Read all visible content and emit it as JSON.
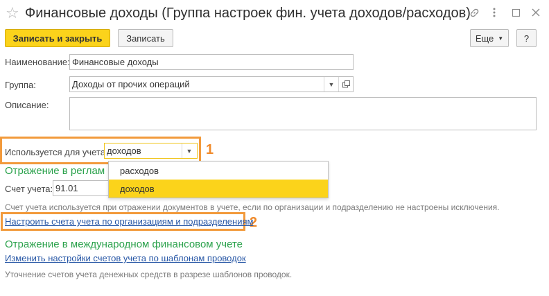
{
  "window": {
    "title": "Финансовые доходы (Группа настроек фин. учета доходов/расходов)"
  },
  "toolbar": {
    "save_close_label": "Записать и закрыть",
    "save_label": "Записать",
    "more_label": "Еще",
    "help_label": "?"
  },
  "form": {
    "name_label": "Наименование:",
    "name_value": "Финансовые доходы",
    "group_label": "Группа:",
    "group_value": "Доходы от прочих операций",
    "description_label": "Описание:",
    "description_value": "",
    "usage_label": "Используется для учета:",
    "usage_value": "доходов",
    "usage_options": [
      {
        "label": "расходов",
        "selected": false
      },
      {
        "label": "доходов",
        "selected": true
      }
    ]
  },
  "regulated": {
    "section_title": "Отражение в реглам",
    "account_label": "Счет учета:",
    "account_value": "91.01",
    "hint": "Счет учета используется при отражении документов в учете, если по организации и подразделению не настроены исключения.",
    "link": "Настроить счета учета по организациям и подразделениям"
  },
  "international": {
    "section_title": "Отражение в международном финансовом учете",
    "link": "Изменить настройки счетов учета по шаблонам проводок",
    "hint": "Уточнение счетов учета денежных средств в разрезе шаблонов проводок."
  },
  "annotations": {
    "marker_1": "1",
    "marker_2": "2"
  },
  "colors": {
    "primary_button": "#fbd31b",
    "section_green": "#2ba24c",
    "link_blue": "#2555a5",
    "annotation_orange": "#f29a3c"
  }
}
